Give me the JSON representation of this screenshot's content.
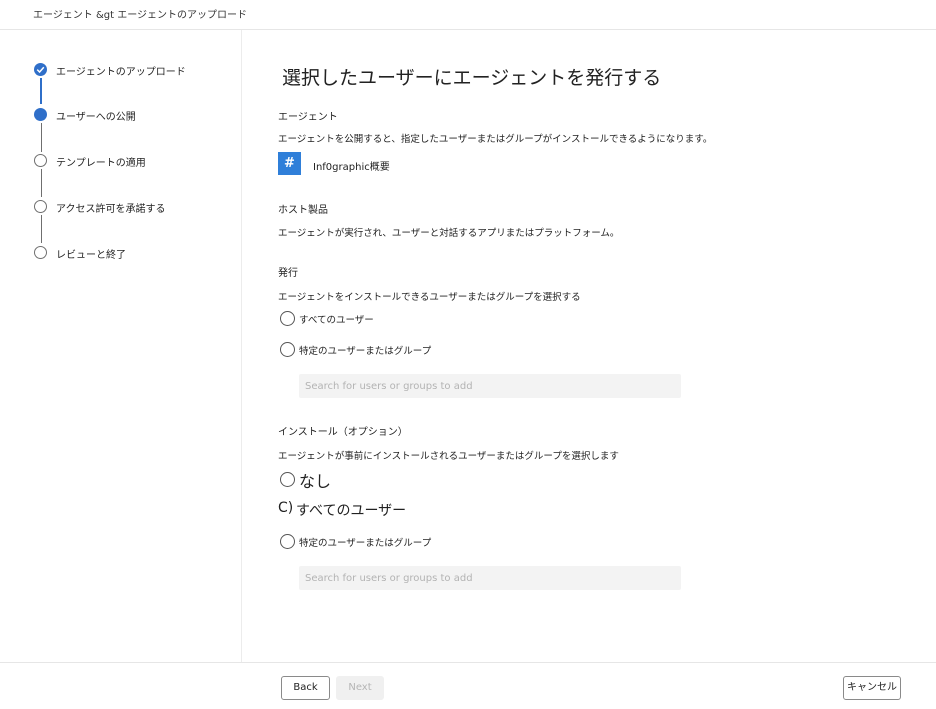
{
  "breadcrumb": "エージェント &gt エージェントのアップロード",
  "steps": [
    {
      "label": "エージェントのアップロード",
      "state": "done"
    },
    {
      "label": "ユーザーへの公開",
      "state": "current"
    },
    {
      "label": "テンプレートの適用",
      "state": "todo"
    },
    {
      "label": "アクセス許可を承諾する",
      "state": "todo"
    },
    {
      "label": "レビューと終了",
      "state": "todo"
    }
  ],
  "main": {
    "title": "選択したユーザーにエージェントを発行する",
    "agent_section": {
      "heading": "エージェント",
      "description": "エージェントを公開すると、指定したユーザーまたはグループがインストールできるようになります。",
      "agent_icon": "#",
      "agent_name": "Inf0graphic概要"
    },
    "host_section": {
      "heading": "ホスト製品",
      "description": "エージェントが実行され、ユーザーと対話するアプリまたはプラットフォーム。"
    },
    "publish_section": {
      "heading": "発行",
      "description": "エージェントをインストールできるユーザーまたはグループを選択する",
      "options": [
        "すべてのユーザー",
        "特定のユーザーまたはグループ"
      ],
      "search_placeholder": "Search for users or groups to add"
    },
    "install_section": {
      "heading": "インストール（オプション）",
      "description": "エージェントが事前にインストールされるユーザーまたはグループを選択します",
      "option_none": "なし",
      "option_all_prefix": "C)",
      "option_all": "すべてのユーザー",
      "option_specific": "特定のユーザーまたはグループ",
      "search_placeholder": "Search for users or groups to add"
    }
  },
  "footer": {
    "back_label": "Back",
    "next_label": "Next",
    "cancel_label": "キャンセル"
  },
  "colors": {
    "accent": "#2f6fc9",
    "agent_tile": "#2f7fd9",
    "disabled_text": "#b5b5b5"
  }
}
